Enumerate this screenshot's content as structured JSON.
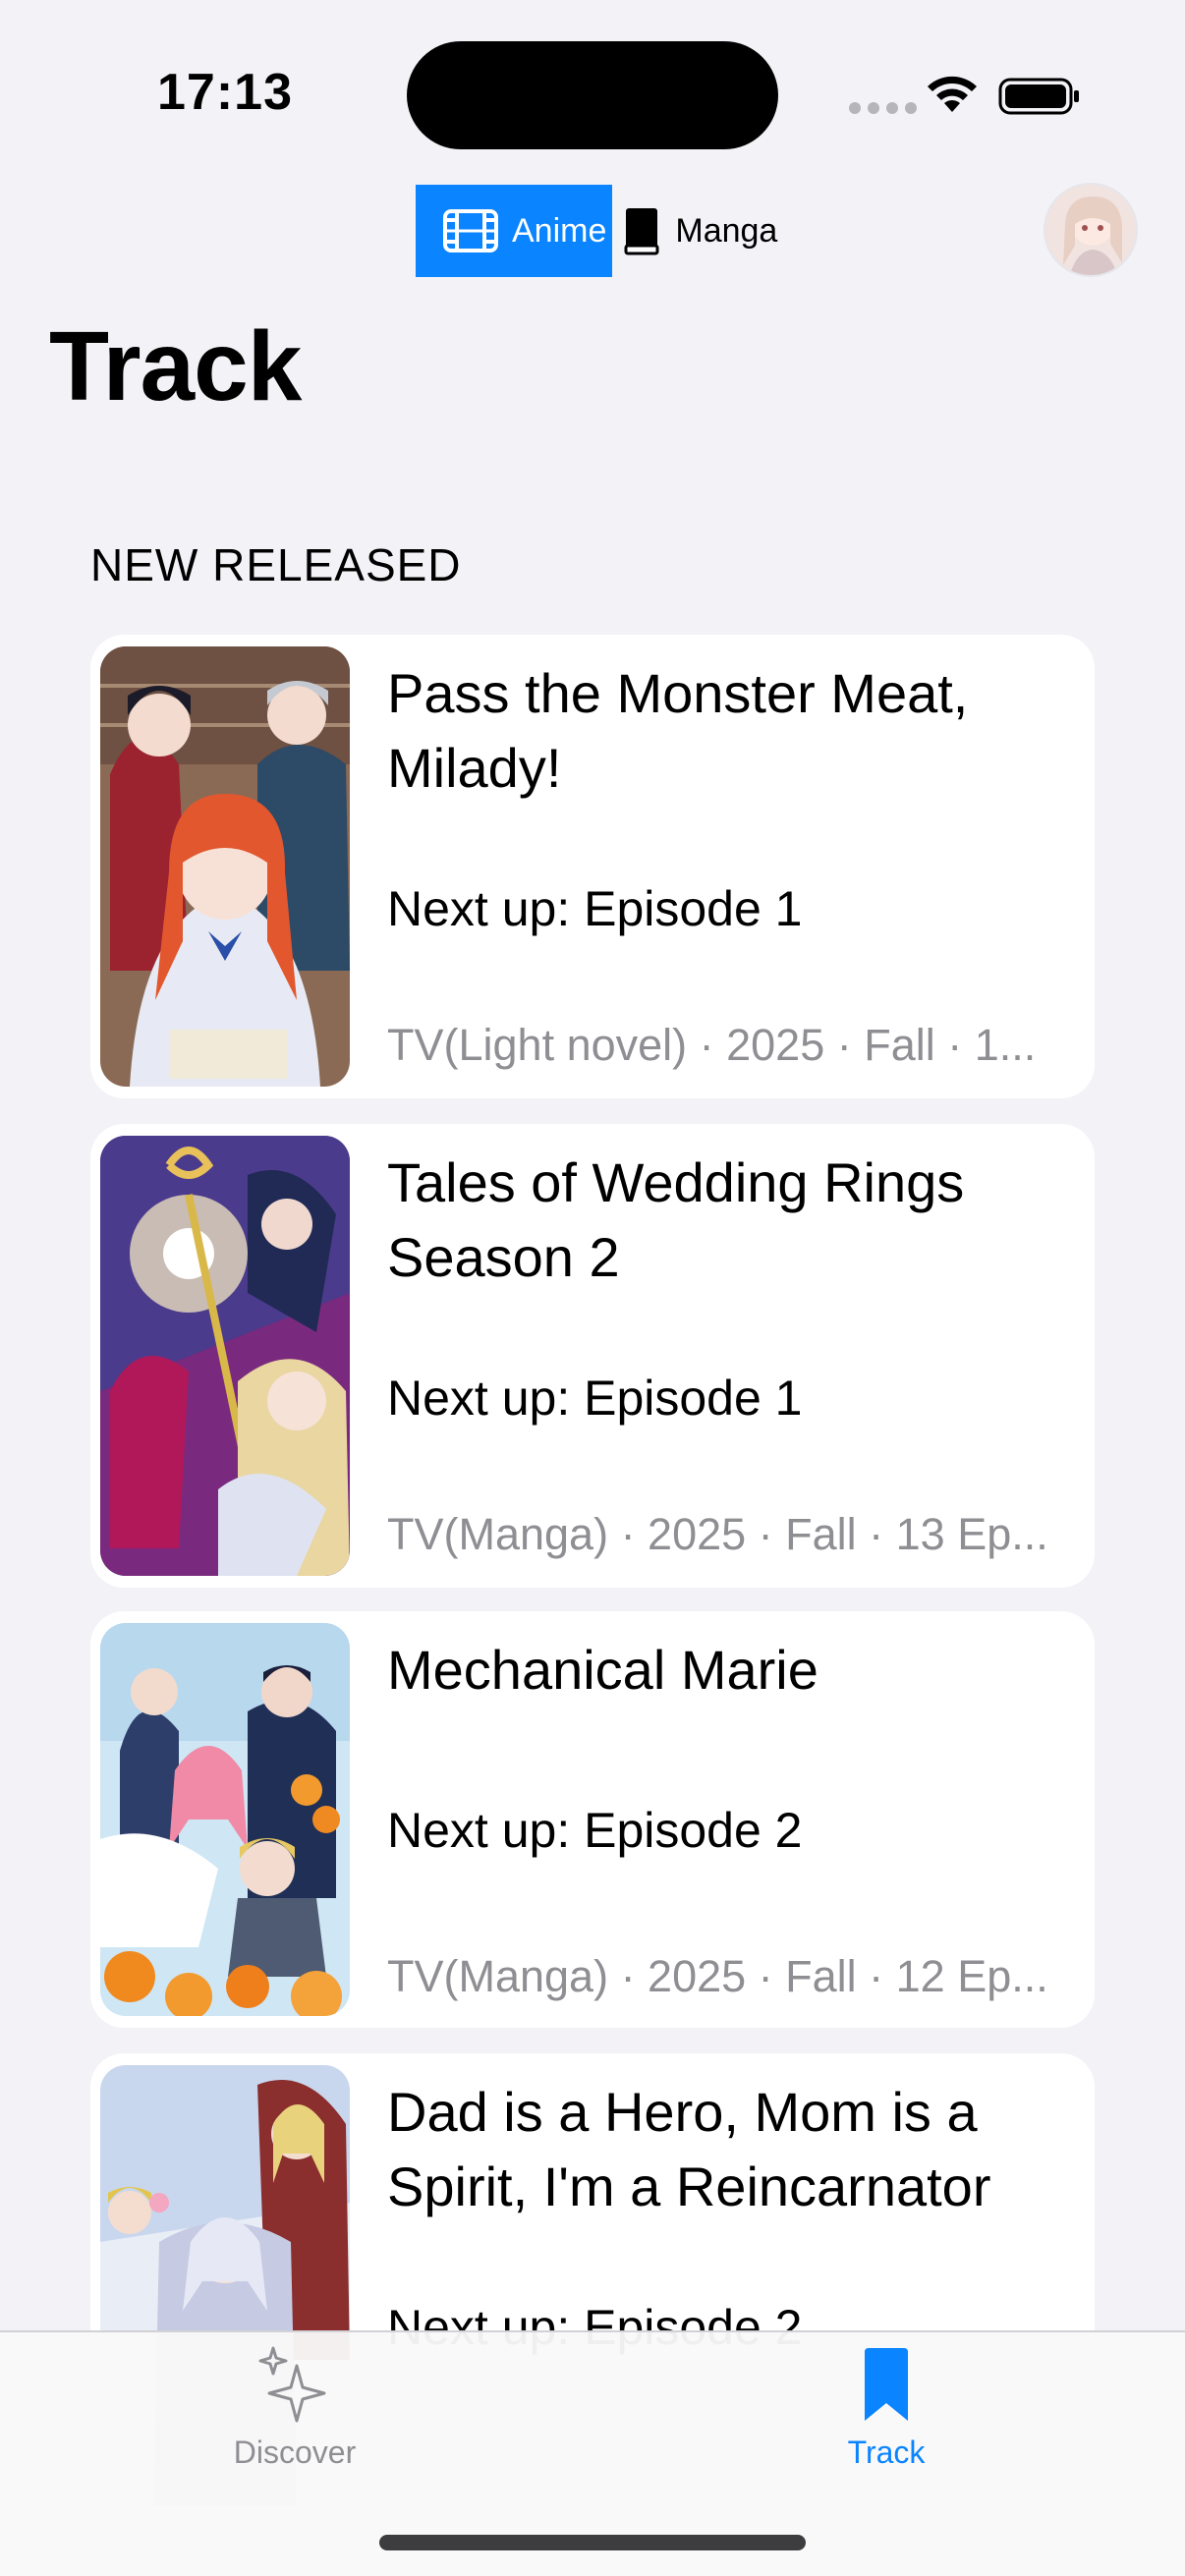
{
  "status_bar": {
    "time": "17:13"
  },
  "segment": {
    "options": [
      {
        "label": "Anime",
        "icon": "film-icon",
        "selected": true
      },
      {
        "label": "Manga",
        "icon": "book-icon",
        "selected": false
      }
    ]
  },
  "page": {
    "title": "Track"
  },
  "section": {
    "header": "NEW RELEASED"
  },
  "items": [
    {
      "title": "Pass the Monster Meat, Milady!",
      "next": "Next up: Episode 1",
      "meta": "TV(Light novel) · 2025 · Fall · 1..."
    },
    {
      "title": "Tales of Wedding Rings Season 2",
      "next": "Next up: Episode 1",
      "meta": "TV(Manga) · 2025 · Fall · 13 Ep..."
    },
    {
      "title": "Mechanical Marie",
      "next": "Next up: Episode 2",
      "meta": "TV(Manga) · 2025 · Fall · 12 Ep..."
    },
    {
      "title": "Dad is a Hero, Mom is a Spirit, I'm a Reincarnator",
      "next": "Next up: Episode 2",
      "meta": ""
    }
  ],
  "tabs": [
    {
      "label": "Discover",
      "icon": "sparkles-icon",
      "selected": false
    },
    {
      "label": "Track",
      "icon": "bookmark-icon",
      "selected": true
    }
  ],
  "colors": {
    "accent": "#0a84ff",
    "secondary_text": "#8e8e93",
    "background": "#f2f2f7"
  }
}
